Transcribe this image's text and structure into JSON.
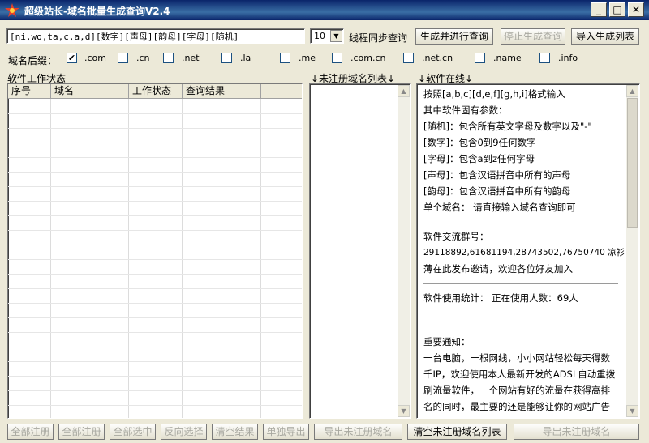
{
  "window": {
    "title": "超级站长-域名批量生成查询V2.4",
    "min": "_",
    "max": "□",
    "close": "✕"
  },
  "toolbar": {
    "pattern_value": "[ni,wo,ta,c,a,d][数字][声母][韵母][字母][随机]",
    "thread_count": "10",
    "thread_label": "线程同步查询",
    "generate_btn": "生成并进行查询",
    "stop_btn": "停止生成查询",
    "import_btn": "导入生成列表"
  },
  "suffix": {
    "label": "域名后缀：",
    "options": [
      {
        "name": ".com",
        "checked": true
      },
      {
        "name": ".cn",
        "checked": false
      },
      {
        "name": ".net",
        "checked": false
      },
      {
        "name": ".la",
        "checked": false
      },
      {
        "name": ".me",
        "checked": false
      },
      {
        "name": ".com.cn",
        "checked": false
      },
      {
        "name": ".net.cn",
        "checked": false
      },
      {
        "name": ".name",
        "checked": false
      },
      {
        "name": ".info",
        "checked": false
      }
    ]
  },
  "panels": {
    "status_title": "软件工作状态",
    "unregistered_title": "↓未注册域名列表↓",
    "online_title": "↓软件在线↓"
  },
  "table": {
    "columns": [
      "序号",
      "域名",
      "工作状态",
      "查询结果"
    ]
  },
  "info": {
    "lines": [
      "按照[a,b,c][d,e,f][g,h,i]格式输入",
      "其中软件固有参数：",
      "[随机]：包含所有英文字母及数字以及\"-\"",
      "[数字]：包含0到9任何数字",
      "[字母]：包含a到z任何字母",
      "[声母]：包含汉语拼音中所有的声母",
      "[韵母]：包含汉语拼音中所有的韵母",
      "单个域名： 请直接输入域名查询即可",
      "软件交流群号：",
      "29118892,61681194,28743502,76750740 凉衫",
      "薄在此发布邀请，欢迎各位好友加入",
      "软件使用统计： 正在使用人数：69人",
      "重要通知：",
      "一台电脑，一根网线，小小网站轻松每天得数",
      "千IP，欢迎使用本人最新开发的ADSL自动重拨",
      "刷流量软件，一个网站有好的流量在获得高排",
      "名的同时，最主要的还是能够让你的网站广告"
    ]
  },
  "bottom": {
    "buttons": [
      "全部注册",
      "全部注册",
      "全部选中",
      "反向选择",
      "清空结果",
      "单独导出",
      "导出未注册域名"
    ],
    "clear_btn": "清空未注册域名列表",
    "last_btn": "导出未注册域名"
  }
}
